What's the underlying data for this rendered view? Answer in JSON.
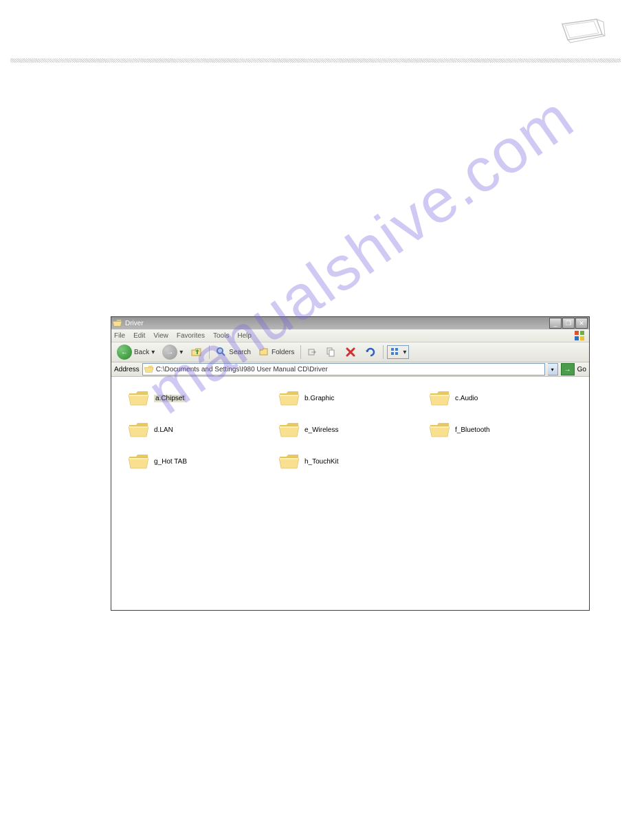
{
  "window": {
    "title": "Driver",
    "minimize": "_",
    "maximize": "❐",
    "close": "✕"
  },
  "menubar": {
    "file": "File",
    "edit": "Edit",
    "view": "View",
    "favorites": "Favorites",
    "tools": "Tools",
    "help": "Help"
  },
  "toolbar": {
    "back": "Back",
    "back_arrow": "←",
    "fwd_arrow": "→",
    "drop": "▾",
    "search": "Search",
    "folders": "Folders"
  },
  "address": {
    "label": "Address",
    "path": "C:\\Documents and Settings\\I980 User Manual CD\\Driver",
    "go": "Go",
    "go_arrow": "→"
  },
  "folders": [
    {
      "label": "a.Chipset",
      "selected": true
    },
    {
      "label": "b.Graphic",
      "selected": false
    },
    {
      "label": "c.Audio",
      "selected": false
    },
    {
      "label": "d.LAN",
      "selected": false
    },
    {
      "label": "e_Wireless",
      "selected": false
    },
    {
      "label": "f_Bluetooth",
      "selected": false
    },
    {
      "label": "g_Hot TAB",
      "selected": false
    },
    {
      "label": "h_TouchKit",
      "selected": false
    }
  ],
  "watermark": "manualshive.com"
}
